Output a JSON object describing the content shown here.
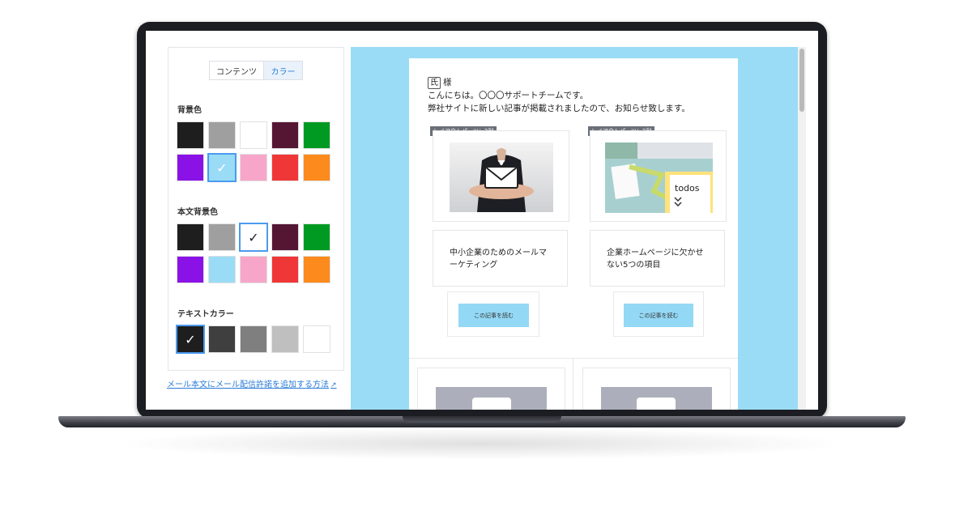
{
  "tabs": {
    "contents": "コンテンツ",
    "color": "カラー"
  },
  "sections": {
    "background": {
      "label": "背景色",
      "swatches": [
        "#1e1e1e",
        "#9f9f9f",
        "#ffffff",
        "#551634",
        "#009a22",
        "#8a12e6",
        "#9adcf5",
        "#f7a6c9",
        "#ef3737",
        "#fd8a1d"
      ],
      "selected_index": 6
    },
    "body_background": {
      "label": "本文背景色",
      "swatches": [
        "#1e1e1e",
        "#9f9f9f",
        "#ffffff",
        "#551634",
        "#009a22",
        "#8a12e6",
        "#9adcf5",
        "#f7a6c9",
        "#ef3737",
        "#fd8a1d"
      ],
      "selected_index": 2
    },
    "text_color": {
      "label": "テキストカラー",
      "swatches": [
        "#1e1e1e",
        "#3f3f3f",
        "#7f7f7f",
        "#bfbfbf",
        "#ffffff"
      ],
      "selected_index": 0
    }
  },
  "help_link": "メール本文にメール配信許諾を追加する方法",
  "email": {
    "name_tag": "氏",
    "honorific": "様",
    "line1": "こんにちは。〇〇〇サポートチームです。",
    "line2": "弊社サイトに新しい記事が掲載されましたので、お知らせ致します。",
    "cards": [
      {
        "layout_label": "レイアウトパーツ：2列",
        "title": "中小企業のためのメールマーケティング",
        "button": "この記事を読む"
      },
      {
        "layout_label": "レイアウトパーツ：2列",
        "title": "企業ホームページに欠かせない5つの項目",
        "button": "この記事を読む",
        "image_text": "todos"
      }
    ]
  },
  "colors": {
    "preview_bg": "#9adcf5",
    "accent": "#2b7bd6",
    "button": "#93d8f5"
  }
}
